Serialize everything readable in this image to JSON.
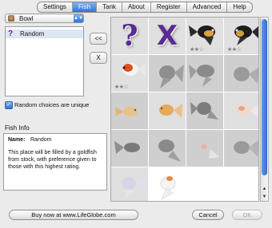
{
  "tabs": [
    "Settings",
    "Fish",
    "Tank",
    "About",
    "Register",
    "Advanced",
    "Help"
  ],
  "active_tab": "Fish",
  "bowl": {
    "value": "Bowl"
  },
  "selected_list": [
    "Random"
  ],
  "buttons": {
    "add_left": "<<",
    "remove": "X",
    "buy": "Buy now at www.LifeGlobe.com",
    "cancel": "Cancel",
    "ok": "OK"
  },
  "checkbox": {
    "label": "Random choices are unique",
    "checked": true
  },
  "fish_info": {
    "title": "Fish Info",
    "name_key": "Name:",
    "name_value": "Random",
    "description": "This place will be filled by a goldfish from stock, with preference given to those with this highest rating."
  },
  "grid_symbols": {
    "random": "?",
    "remove": "X"
  },
  "grid_ratings": {
    "cell3": "★★☆",
    "cell4": "★★☆",
    "cell5": "★★☆"
  },
  "colors": {
    "accent": "#2f74d2",
    "purple": "#5a2b92"
  }
}
